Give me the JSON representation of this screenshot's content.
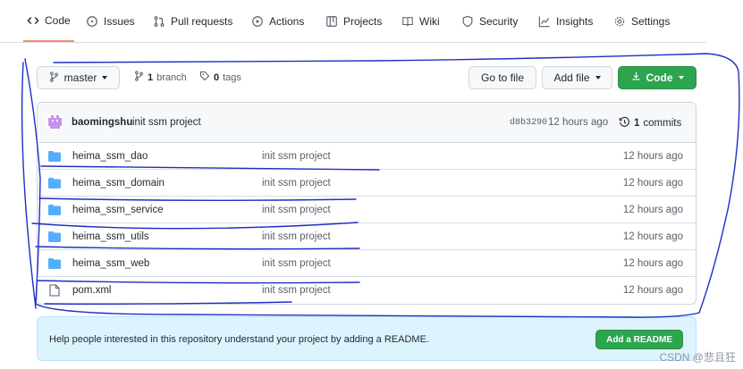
{
  "nav": {
    "tabs": [
      {
        "label": "Code",
        "icon": "code-icon",
        "active": true
      },
      {
        "label": "Issues",
        "icon": "issue-icon"
      },
      {
        "label": "Pull requests",
        "icon": "pull-request-icon"
      },
      {
        "label": "Actions",
        "icon": "play-icon"
      },
      {
        "label": "Projects",
        "icon": "table-icon"
      },
      {
        "label": "Wiki",
        "icon": "book-icon"
      },
      {
        "label": "Security",
        "icon": "shield-icon"
      },
      {
        "label": "Insights",
        "icon": "graph-icon"
      },
      {
        "label": "Settings",
        "icon": "gear-icon"
      }
    ]
  },
  "toolbar": {
    "branch_label": "master",
    "branch_count": "1",
    "branch_word": "branch",
    "tag_count": "0",
    "tag_word": "tags",
    "go_to_file": "Go to file",
    "add_file": "Add file",
    "code_button": "Code"
  },
  "commit": {
    "user": "baomingshu",
    "message": "init ssm project",
    "sha": "d8b3290",
    "time": "12 hours ago",
    "count": "1",
    "count_word": "commits"
  },
  "files": [
    {
      "name": "heima_ssm_dao",
      "type": "dir",
      "message": "init ssm project",
      "time": "12 hours ago"
    },
    {
      "name": "heima_ssm_domain",
      "type": "dir",
      "message": "init ssm project",
      "time": "12 hours ago"
    },
    {
      "name": "heima_ssm_service",
      "type": "dir",
      "message": "init ssm project",
      "time": "12 hours ago"
    },
    {
      "name": "heima_ssm_utils",
      "type": "dir",
      "message": "init ssm project",
      "time": "12 hours ago"
    },
    {
      "name": "heima_ssm_web",
      "type": "dir",
      "message": "init ssm project",
      "time": "12 hours ago"
    },
    {
      "name": "pom.xml",
      "type": "file",
      "message": "init ssm project",
      "time": "12 hours ago"
    }
  ],
  "readme": {
    "text": "Help people interested in this repository understand your project by adding a README.",
    "button": "Add a README"
  },
  "watermark": "CSDN @悲且狂",
  "colors": {
    "accent_green": "#2da44e",
    "folder_blue": "#54aeff",
    "annotation_blue": "#1f2fc4",
    "active_tab_underline": "#fd8c73"
  }
}
